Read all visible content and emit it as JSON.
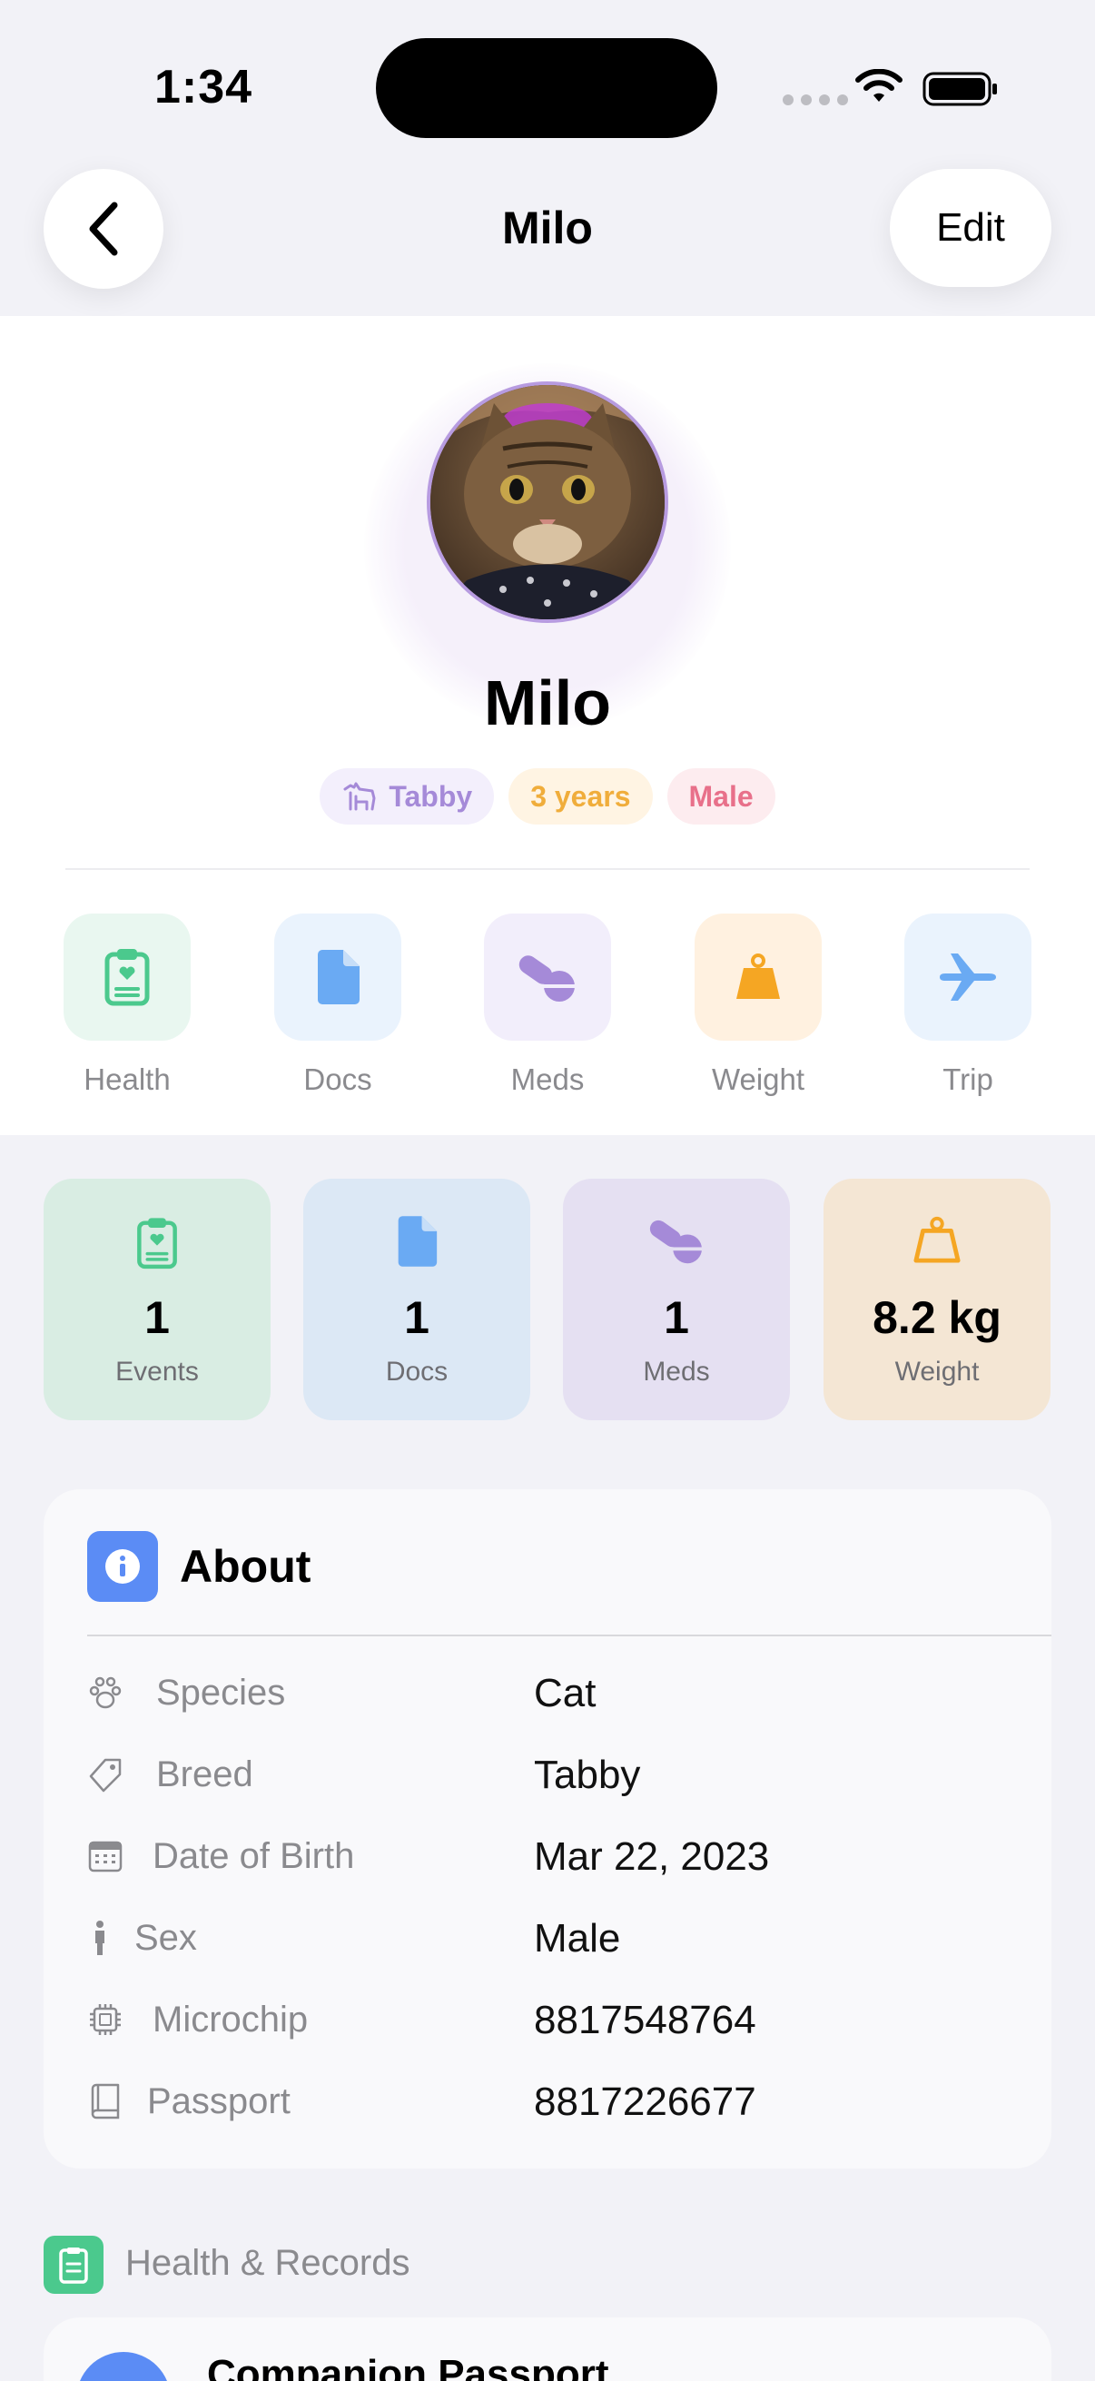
{
  "status_bar": {
    "time": "1:34"
  },
  "nav": {
    "title": "Milo",
    "edit_label": "Edit"
  },
  "pet": {
    "name": "Milo",
    "badges": {
      "breed": "Tabby",
      "age": "3 years",
      "sex": "Male"
    }
  },
  "quick_actions": [
    {
      "label": "Health",
      "icon": "clipboard-heart-icon",
      "color": "#4bc98d",
      "bg": "#e9f7f0"
    },
    {
      "label": "Docs",
      "icon": "document-icon",
      "color": "#6aaaf3",
      "bg": "#eaf3fd"
    },
    {
      "label": "Meds",
      "icon": "pills-icon",
      "color": "#a58ad8",
      "bg": "#f2eefb"
    },
    {
      "label": "Weight",
      "icon": "weight-icon",
      "color": "#f5a623",
      "bg": "#fff1e0"
    },
    {
      "label": "Trip",
      "icon": "airplane-icon",
      "color": "#6aaaf3",
      "bg": "#eaf3fd"
    }
  ],
  "stats": [
    {
      "value": "1",
      "label": "Events",
      "icon": "clipboard-heart-icon",
      "color": "#4bc98d",
      "bg": "#d9ede3"
    },
    {
      "value": "1",
      "label": "Docs",
      "icon": "document-icon",
      "color": "#6aaaf3",
      "bg": "#dce8f5"
    },
    {
      "value": "1",
      "label": "Meds",
      "icon": "pills-icon",
      "color": "#a58ad8",
      "bg": "#e5e0f2"
    },
    {
      "value": "8.2 kg",
      "label": "Weight",
      "icon": "weight-icon",
      "color": "#f5a623",
      "bg": "#f4e6d4"
    }
  ],
  "about": {
    "title": "About",
    "rows": [
      {
        "label": "Species",
        "value": "Cat",
        "icon": "paw-icon"
      },
      {
        "label": "Breed",
        "value": "Tabby",
        "icon": "tag-icon"
      },
      {
        "label": "Date of Birth",
        "value": "Mar 22, 2023",
        "icon": "calendar-icon"
      },
      {
        "label": "Sex",
        "value": "Male",
        "icon": "person-icon"
      },
      {
        "label": "Microchip",
        "value": "8817548764",
        "icon": "chip-icon"
      },
      {
        "label": "Passport",
        "value": "8817226677",
        "icon": "book-icon"
      }
    ]
  },
  "health_records": {
    "title": "Health & Records",
    "first_item": "Companion Passport"
  }
}
